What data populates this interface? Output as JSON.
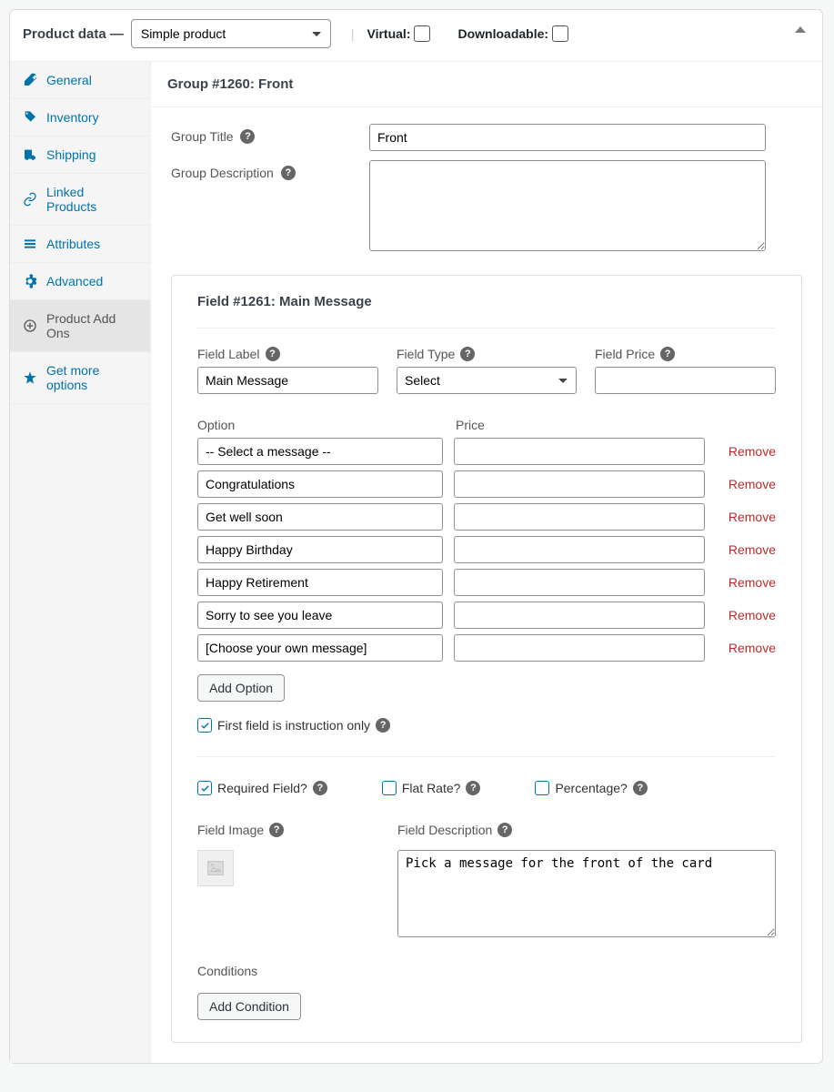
{
  "header": {
    "title": "Product data —",
    "product_type": "Simple product",
    "virtual_label": "Virtual:",
    "downloadable_label": "Downloadable:"
  },
  "sidebar": {
    "items": [
      {
        "label": "General"
      },
      {
        "label": "Inventory"
      },
      {
        "label": "Shipping"
      },
      {
        "label": "Linked Products"
      },
      {
        "label": "Attributes"
      },
      {
        "label": "Advanced"
      },
      {
        "label": "Product Add Ons"
      },
      {
        "label": "Get more options"
      }
    ]
  },
  "group": {
    "heading": "Group #1260: Front",
    "title_label": "Group Title",
    "title_value": "Front",
    "desc_label": "Group Description",
    "desc_value": ""
  },
  "field": {
    "heading": "Field #1261: Main Message",
    "label_label": "Field Label",
    "label_value": "Main Message",
    "type_label": "Field Type",
    "type_value": "Select",
    "price_label": "Field Price",
    "price_value": "",
    "option_header": "Option",
    "price_header": "Price",
    "options": [
      {
        "label": "-- Select a message --",
        "price": ""
      },
      {
        "label": "Congratulations",
        "price": ""
      },
      {
        "label": "Get well soon",
        "price": ""
      },
      {
        "label": "Happy Birthday",
        "price": ""
      },
      {
        "label": "Happy Retirement",
        "price": ""
      },
      {
        "label": "Sorry to see you leave",
        "price": ""
      },
      {
        "label": "[Choose your own message]",
        "price": ""
      }
    ],
    "remove_label": "Remove",
    "add_option_label": "Add Option",
    "first_instruction_label": "First field is instruction only",
    "required_label": "Required Field?",
    "flat_rate_label": "Flat Rate?",
    "percentage_label": "Percentage?",
    "field_image_label": "Field Image",
    "field_desc_label": "Field Description",
    "field_desc_value": "Pick a message for the front of the card",
    "conditions_label": "Conditions",
    "add_condition_label": "Add Condition"
  }
}
